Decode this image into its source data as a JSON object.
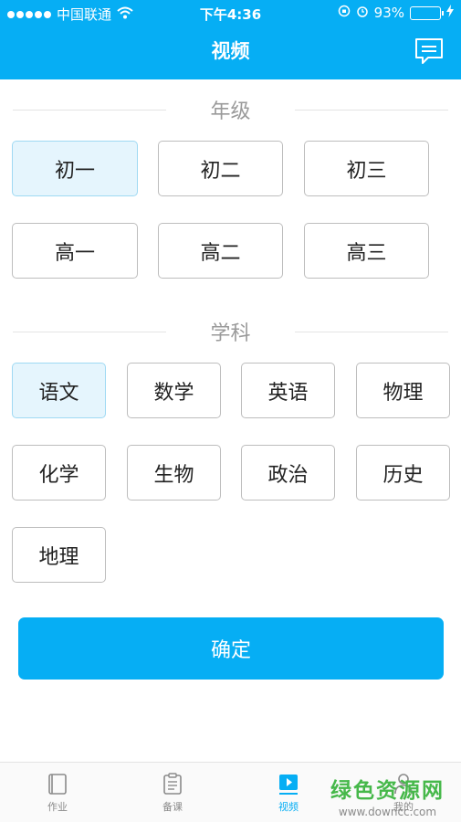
{
  "status_bar": {
    "carrier": "中国联通",
    "time": "下午4:36",
    "battery_pct": "93%",
    "battery_level": 0.93
  },
  "nav": {
    "title": "视频",
    "message_icon": "message-icon"
  },
  "grade": {
    "title": "年级",
    "options": [
      "初一",
      "初二",
      "初三",
      "高一",
      "高二",
      "高三"
    ],
    "selected": "初一"
  },
  "subject": {
    "title": "学科",
    "options": [
      "语文",
      "数学",
      "英语",
      "物理",
      "化学",
      "生物",
      "政治",
      "历史",
      "地理"
    ],
    "selected": "语文"
  },
  "confirm_label": "确定",
  "tabs": [
    {
      "label": "作业",
      "icon": "book-icon",
      "active": false
    },
    {
      "label": "备课",
      "icon": "clipboard-icon",
      "active": false
    },
    {
      "label": "视频",
      "icon": "play-icon",
      "active": true
    },
    {
      "label": "我的",
      "icon": "user-icon",
      "active": false
    }
  ],
  "watermark": {
    "name": "绿色资源网",
    "url": "www.downcc.com"
  },
  "colors": {
    "primary": "#06aef4",
    "selected_bg": "#e5f5fd",
    "watermark": "#46b84a"
  }
}
